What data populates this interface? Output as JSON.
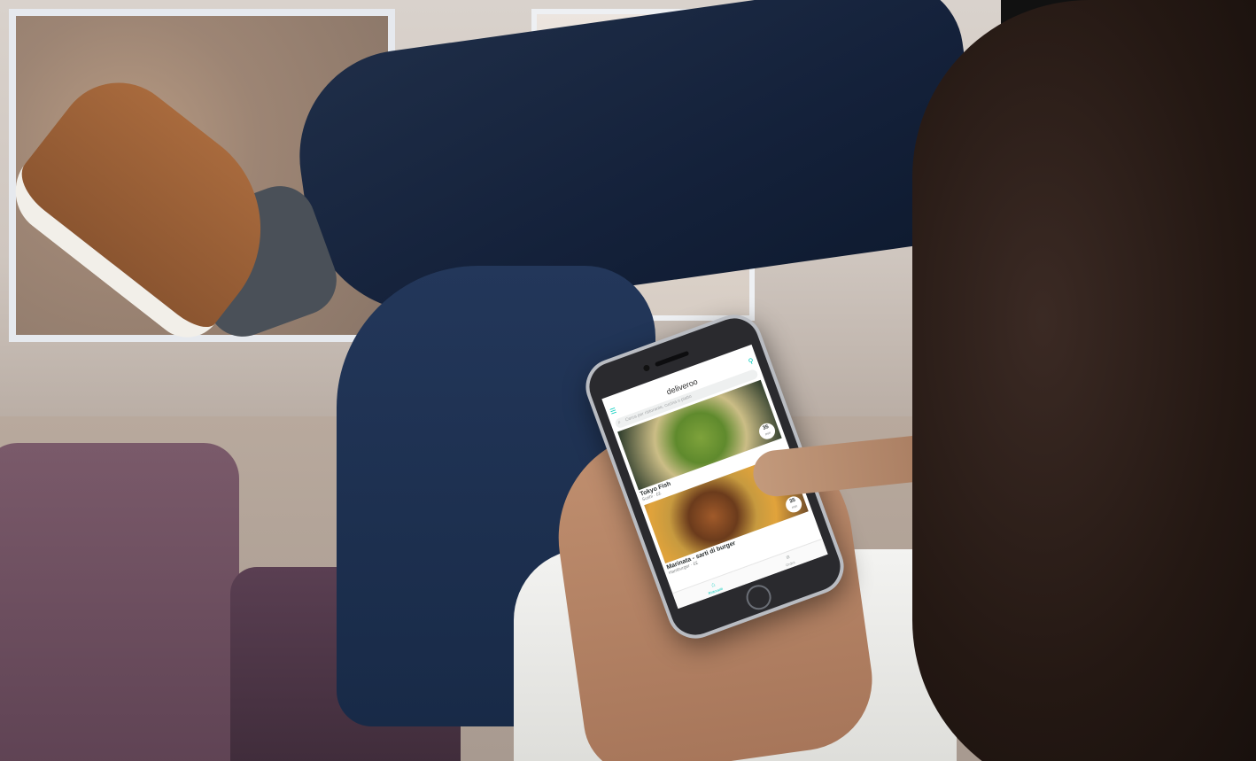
{
  "app": {
    "name": "deliveroo",
    "accent_color": "#00ccbc"
  },
  "status_bar": {
    "carrier": "",
    "time": "",
    "battery": ""
  },
  "search": {
    "placeholder": "Cerca per ristorante, cucina o piatto"
  },
  "restaurants": [
    {
      "name": "Tokyo Fish",
      "subtitle": "Sushi · ££",
      "eta": "35",
      "eta_unit": "min"
    },
    {
      "name": "Marinata - sarti di burger",
      "subtitle": "Hamburger · ££",
      "eta": "35",
      "eta_unit": "min"
    }
  ],
  "tab_bar": {
    "items": [
      {
        "label": "Ristoranti",
        "icon": "restaurant-icon"
      },
      {
        "label": "Ordini",
        "icon": "orders-icon"
      }
    ]
  }
}
